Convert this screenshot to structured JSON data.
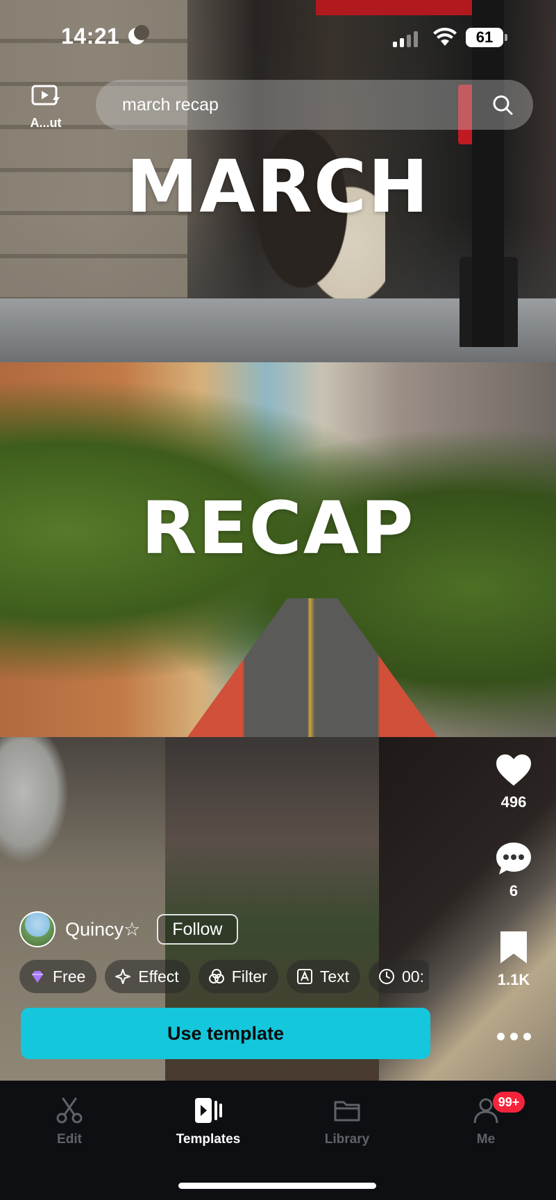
{
  "status_bar": {
    "time": "14:21",
    "battery": "61"
  },
  "autocut": {
    "label": "A...ut",
    "icon": "autocut-icon"
  },
  "search": {
    "query": "march recap",
    "icon": "search-icon"
  },
  "video": {
    "title_line1": "MARCH",
    "title_line2": "RECAP"
  },
  "actions": {
    "like_count": "496",
    "comment_count": "6",
    "save_count": "1.1K",
    "more_icon": "more-dots-icon"
  },
  "author": {
    "name": "Quincy☆",
    "follow_label": "Follow"
  },
  "chips": [
    {
      "label": "Free",
      "icon": "diamond-icon"
    },
    {
      "label": "Effect",
      "icon": "sparkle-icon"
    },
    {
      "label": "Filter",
      "icon": "filter-icon"
    },
    {
      "label": "Text",
      "icon": "text-icon"
    },
    {
      "label": "00:",
      "icon": "clock-icon"
    }
  ],
  "use_template_label": "Use template",
  "tabs": [
    {
      "label": "Edit",
      "icon": "scissors-icon",
      "active": false
    },
    {
      "label": "Templates",
      "icon": "templates-icon",
      "active": true
    },
    {
      "label": "Library",
      "icon": "folder-icon",
      "active": false
    },
    {
      "label": "Me",
      "icon": "person-icon",
      "active": false,
      "badge": "99+"
    }
  ],
  "colors": {
    "accent": "#14c7dc",
    "badge": "#f5243b",
    "tabbar": "#0d0f12"
  }
}
